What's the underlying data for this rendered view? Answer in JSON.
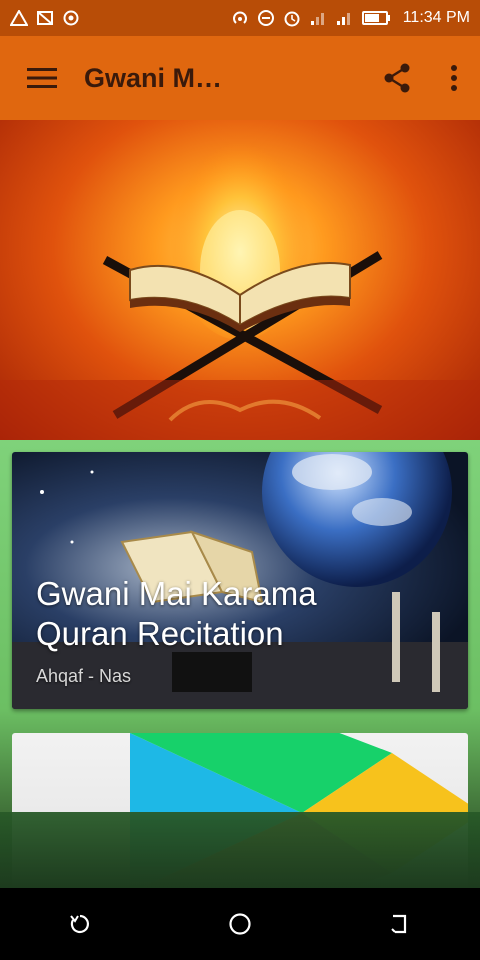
{
  "status_bar": {
    "time": "11:34 PM",
    "left_icons": [
      "warning-triangle-icon",
      "cast-off-icon",
      "target-icon"
    ],
    "right_icons": [
      "hotspot-icon",
      "do-not-disturb-icon",
      "alarm-icon",
      "signal-icon",
      "signal-icon",
      "battery-icon"
    ]
  },
  "toolbar": {
    "title": "Gwani Mai Kar...",
    "menu_icon": "hamburger-menu-icon",
    "share_icon": "share-icon",
    "overflow_icon": "more-vert-icon"
  },
  "cards": [
    {
      "title": "Gwani Mai Karama Quran Recitation",
      "subtitle": "Ahqaf - Nas"
    }
  ],
  "colors": {
    "status_bar": "#b84d07",
    "toolbar": "#e0670f",
    "title_text": "#3a1a0b",
    "content_bg": "#7fd27a"
  },
  "navbar": {
    "icons": [
      "recents-icon",
      "home-icon",
      "back-icon"
    ]
  }
}
